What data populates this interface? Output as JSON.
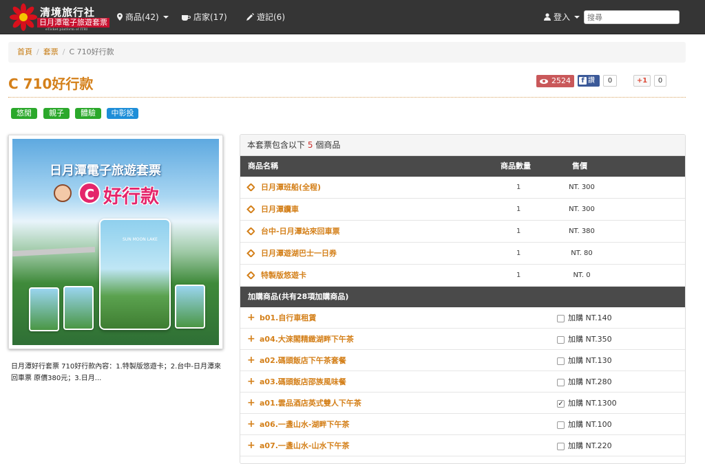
{
  "nav": {
    "brand_name": "清境旅行社",
    "brand_sub": "日月潭電子旅遊套票",
    "brand_en": "eTicket platform of ITRI",
    "products": "商品(42)",
    "stores": "店家(17)",
    "travelogues": "遊記(6)",
    "login": "登入",
    "search_placeholder": "搜尋"
  },
  "breadcrumb": {
    "home": "首頁",
    "package": "套票",
    "current": "C 710好行款"
  },
  "title": "C 710好行款",
  "social": {
    "views": "2524",
    "fb_label": "讚",
    "fb_count": "0",
    "gplus_label": "+1",
    "gplus_count": "0"
  },
  "tags": [
    {
      "label": "悠閒",
      "color": "#2ba82b"
    },
    {
      "label": "親子",
      "color": "#2ba82b"
    },
    {
      "label": "體驗",
      "color": "#2ba82b"
    },
    {
      "label": "中彰投",
      "color": "#1e8ed8"
    }
  ],
  "image": {
    "title": "日月潭電子旅遊套票",
    "c_letter": "C",
    "subtitle": "好行款",
    "card_text": "SUN MOON LAKE"
  },
  "description": "日月潭好行套票 710好行款內容：1.特製版悠遊卡；2.台中-日月潭來回車票 原價380元；3.日月...",
  "panel": {
    "heading_pre": "本套票包含以下",
    "heading_count": "5",
    "heading_post": "個商品",
    "col_name": "商品名稱",
    "col_qty": "商品數量",
    "col_price": "售價",
    "items": [
      {
        "name": "日月潭班船(全程)",
        "qty": "1",
        "price": "NT. 300"
      },
      {
        "name": "日月潭纜車",
        "qty": "1",
        "price": "NT. 300"
      },
      {
        "name": "台中-日月潭站來回車票",
        "qty": "1",
        "price": "NT. 380"
      },
      {
        "name": "日月潭遊湖巴士一日券",
        "qty": "1",
        "price": "NT. 80"
      },
      {
        "name": "特製版悠遊卡",
        "qty": "1",
        "price": "NT. 0"
      }
    ],
    "addon_heading": "加購商品(共有28項加購商品)",
    "addons": [
      {
        "name": "b01.自行車租賃",
        "label": "加購 NT.140",
        "checked": false
      },
      {
        "name": "a04.大淶閣精緻湖畔下午茶",
        "label": "加購 NT.350",
        "checked": false
      },
      {
        "name": "a02.碼頭飯店下午茶套餐",
        "label": "加購 NT.130",
        "checked": false
      },
      {
        "name": "a03.碼頭飯店邵族風味餐",
        "label": "加購 NT.280",
        "checked": false
      },
      {
        "name": "a01.雲品酒店英式雙人下午茶",
        "label": "加購 NT.1300",
        "checked": true
      },
      {
        "name": "a06.一盞山水-湖畔下午茶",
        "label": "加購 NT.100",
        "checked": false
      },
      {
        "name": "a07.一盞山水-山水下午茶",
        "label": "加購 NT.220",
        "checked": false
      }
    ]
  }
}
